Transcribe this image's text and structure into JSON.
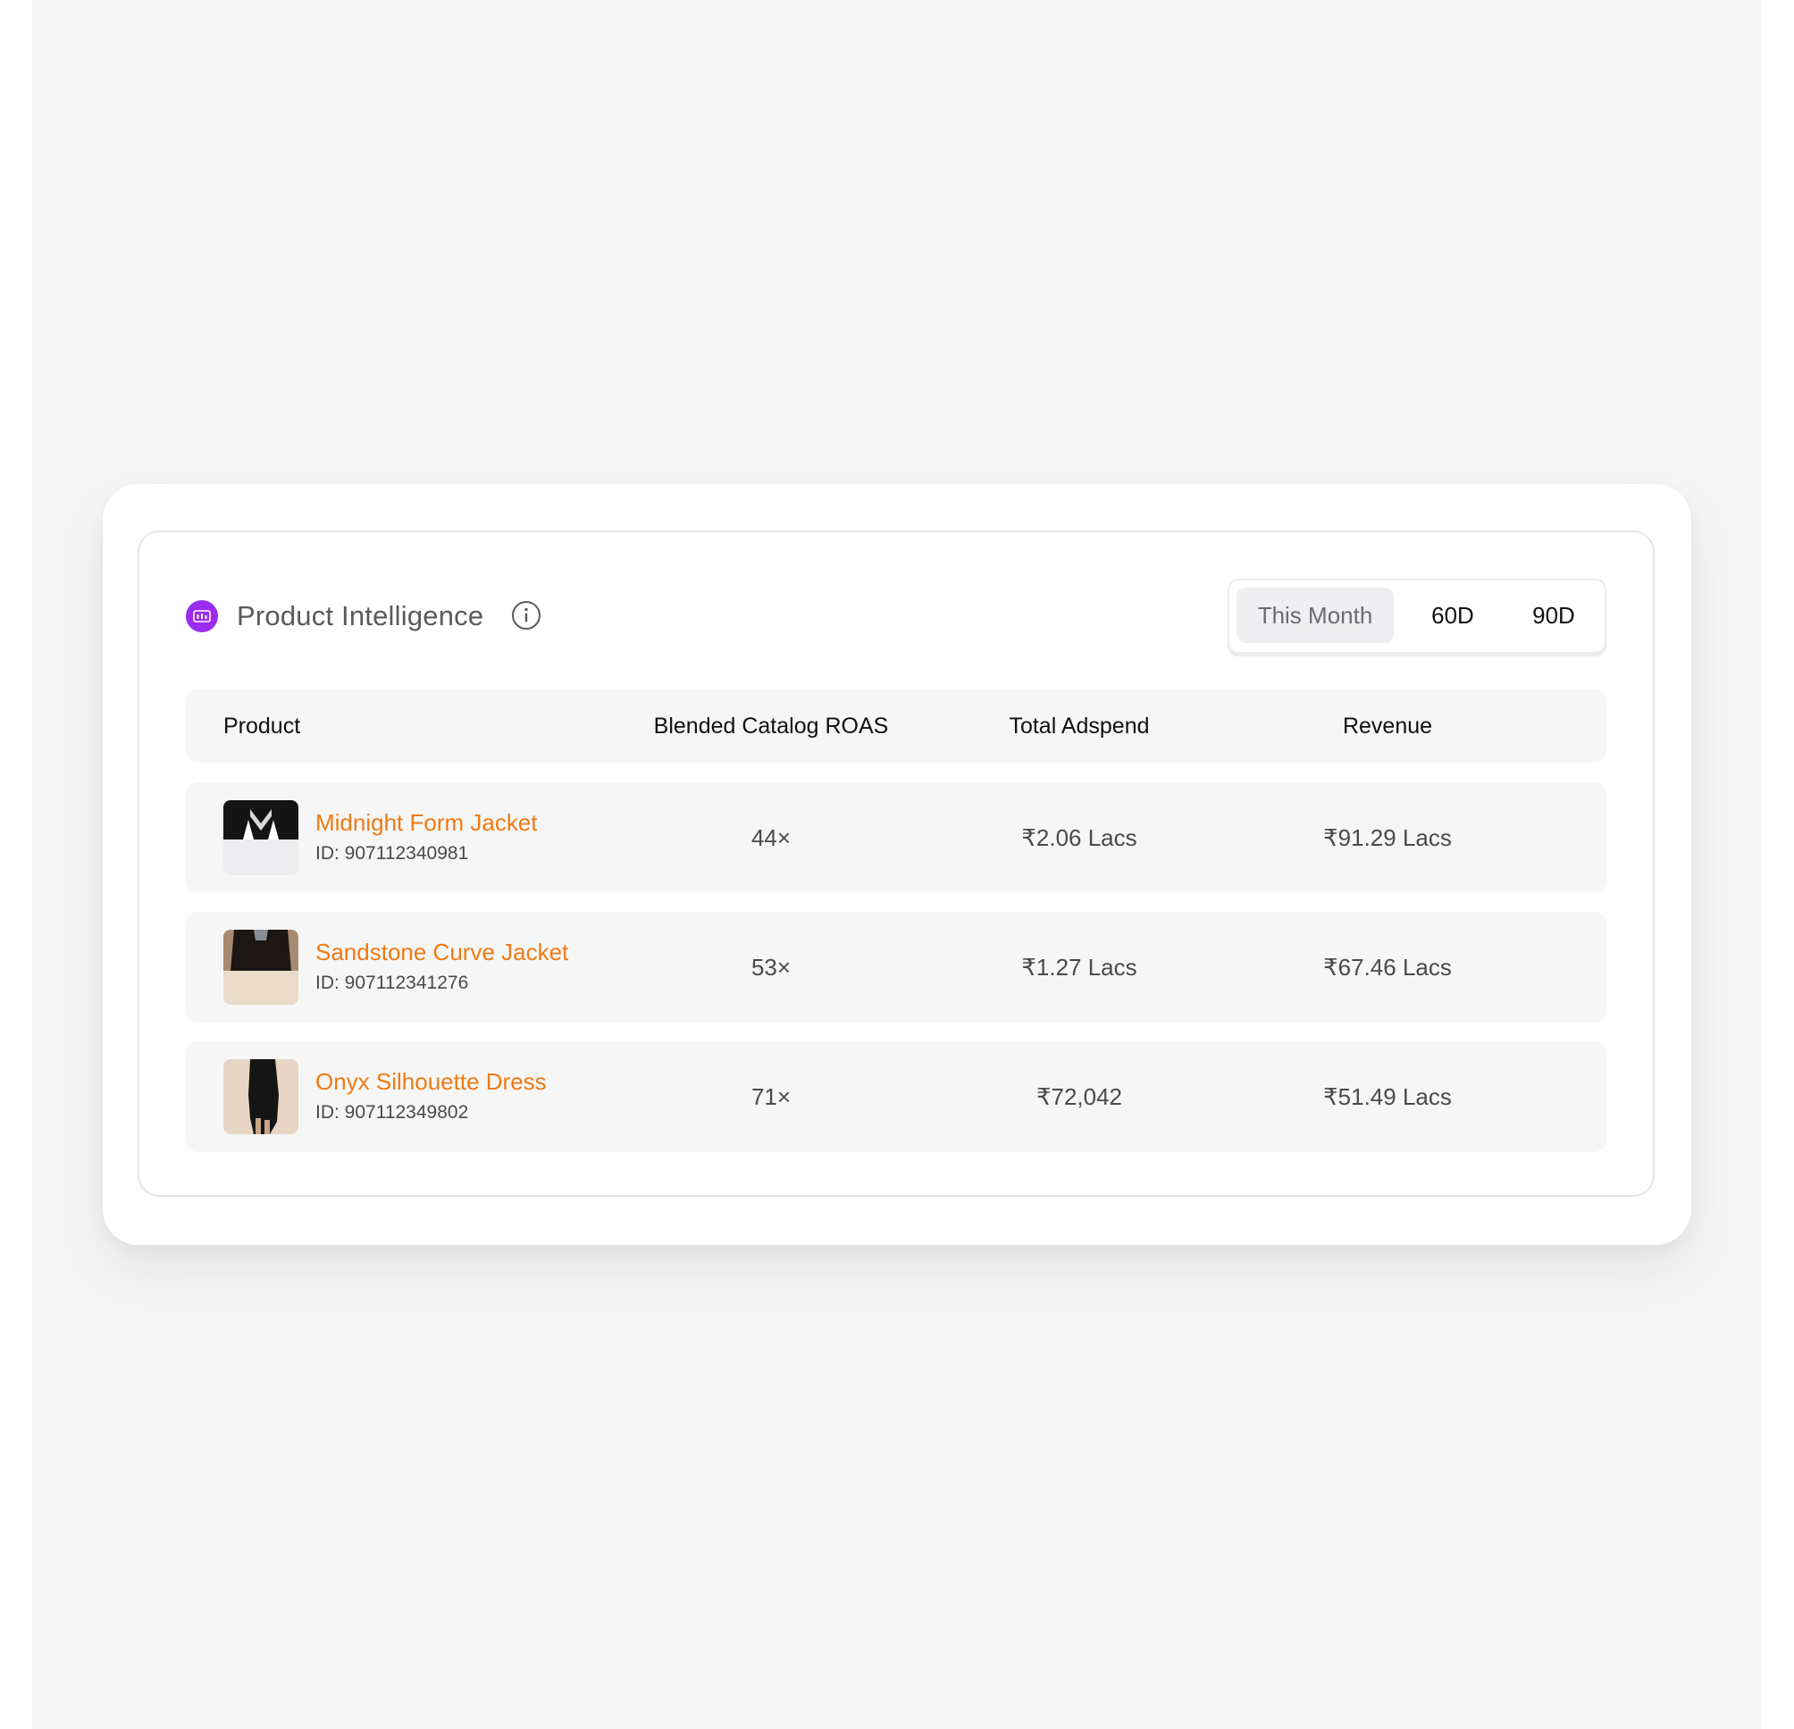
{
  "widget": {
    "title": "Product Intelligence",
    "icons": {
      "brand": "analytics-widget-icon",
      "info": "info-icon"
    },
    "accent_color": "#9b2cf0",
    "range_options": [
      {
        "label": "This Month",
        "selected": true
      },
      {
        "label": "60D",
        "selected": false
      },
      {
        "label": "90D",
        "selected": false
      }
    ]
  },
  "table": {
    "columns": [
      "Product",
      "Blended Catalog ROAS",
      "Total Adspend",
      "Revenue"
    ],
    "link_color": "#f07a12",
    "rows": [
      {
        "name": "Midnight Form Jacket",
        "id": "ID: 907112340981",
        "roas": "44×",
        "adspend": "₹2.06 Lacs",
        "revenue": "₹91.29 Lacs"
      },
      {
        "name": "Sandstone Curve Jacket",
        "id": "ID: 907112341276",
        "roas": "53×",
        "adspend": "₹1.27 Lacs",
        "revenue": "₹67.46 Lacs"
      },
      {
        "name": "Onyx Silhouette Dress",
        "id": "ID: 907112349802",
        "roas": "71×",
        "adspend": "₹72,042",
        "revenue": "₹51.49 Lacs"
      }
    ]
  }
}
